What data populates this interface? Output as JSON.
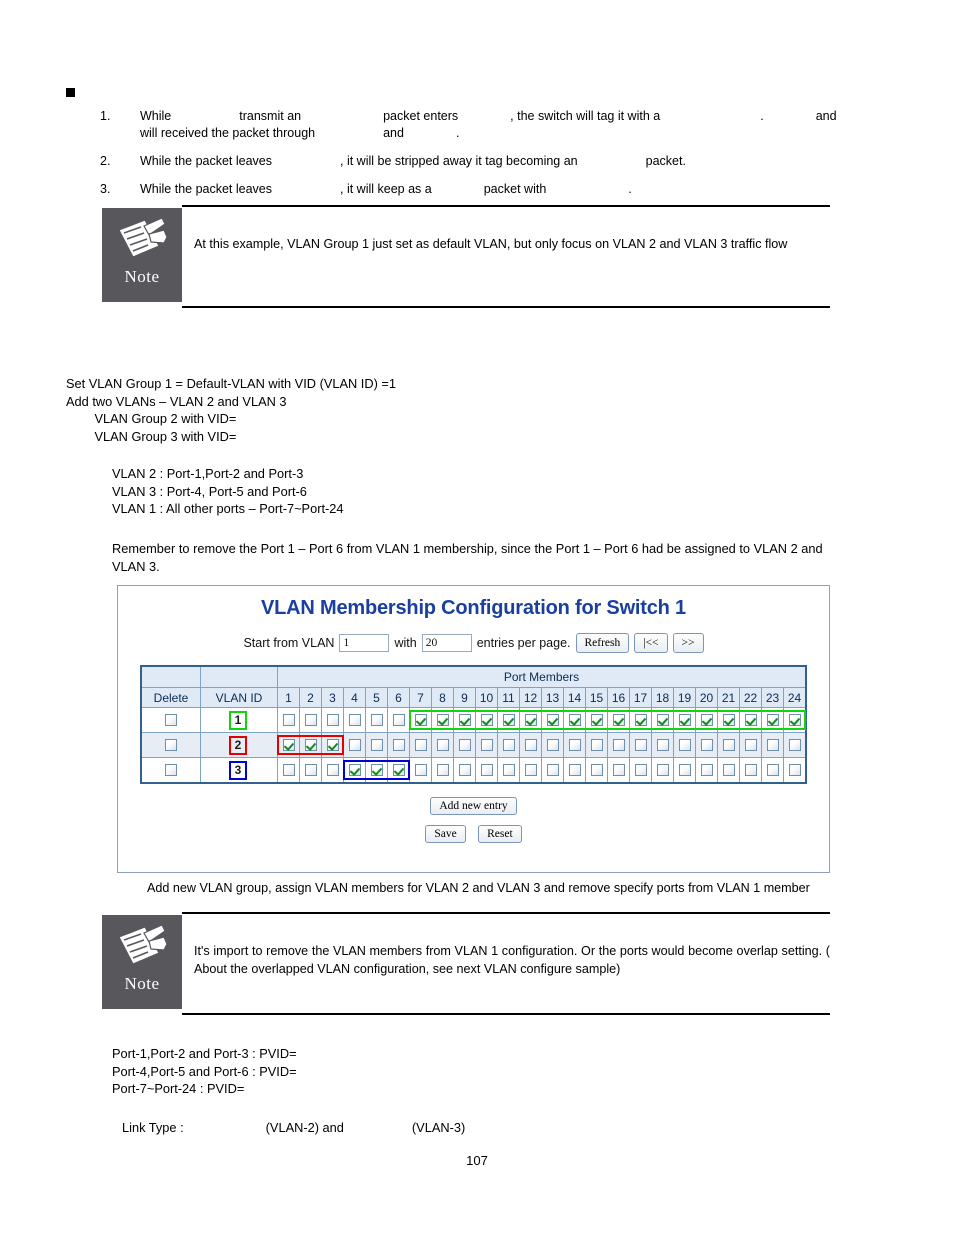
{
  "top_list": {
    "bullet": "square-bullet",
    "items": [
      {
        "num": "1.",
        "line1_a": "While",
        "line1_b": "transmit an",
        "line1_c": "packet enters",
        "line1_d": ", the switch will tag it with a",
        "line1_e": ".",
        "line1_f": "and",
        "line2_a": "will received the packet through",
        "line2_b": "and",
        "line2_c": "."
      },
      {
        "num": "2.",
        "line1_a": "While the packet leaves",
        "line1_b": ", it will be stripped away it tag becoming an",
        "line1_c": "packet."
      },
      {
        "num": "3.",
        "line1_a": "While the packet leaves",
        "line1_b": ", it will keep as a",
        "line1_c": "packet with",
        "line1_d": "."
      }
    ]
  },
  "note_top": {
    "label": "Note",
    "icon": "note-pencil-icon",
    "text": "At this example, VLAN Group 1 just set as default VLAN, but only focus on VLAN 2 and VLAN 3 traffic flow"
  },
  "config_text": {
    "block1": "Set VLAN Group 1 = Default-VLAN with VID (VLAN ID) =1\nAdd two VLANs – VLAN 2 and VLAN 3\n        VLAN Group 2 with VID=\n        VLAN Group 3 with VID=",
    "block2": "VLAN 2 : Port-1,Port-2 and Port-3\nVLAN 3 : Port-4, Port-5 and Port-6\nVLAN 1 : All other ports – Port-7~Port-24",
    "block3": "Remember to remove the Port 1 – Port 6 from VLAN 1 membership, since the Port 1 – Port 6 had be assigned to VLAN 2 and\nVLAN 3."
  },
  "vlan_panel": {
    "title": "VLAN Membership Configuration for Switch 1",
    "controls": {
      "start_label": "Start from VLAN",
      "start_value": "1",
      "with_label": "with",
      "entries_value": "20",
      "entries_label": "entries per page.",
      "refresh_label": "Refresh",
      "first_label": "|<<",
      "next_label": ">>"
    },
    "table": {
      "port_members_header": "Port Members",
      "delete_header": "Delete",
      "vlan_id_header": "VLAN ID",
      "ports": [
        "1",
        "2",
        "3",
        "4",
        "5",
        "6",
        "7",
        "8",
        "9",
        "10",
        "11",
        "12",
        "13",
        "14",
        "15",
        "16",
        "17",
        "18",
        "19",
        "20",
        "21",
        "22",
        "23",
        "24"
      ],
      "rows": [
        {
          "vlan_id": "1",
          "vid_highlight": "#12d312",
          "delete_checked": false,
          "members": [
            false,
            false,
            false,
            false,
            false,
            false,
            true,
            true,
            true,
            true,
            true,
            true,
            true,
            true,
            true,
            true,
            true,
            true,
            true,
            true,
            true,
            true,
            true,
            true
          ],
          "band": {
            "color": "#12d312",
            "from": 7,
            "to": 24
          }
        },
        {
          "vlan_id": "2",
          "vid_highlight": "#e60000",
          "delete_checked": false,
          "members": [
            true,
            true,
            true,
            false,
            false,
            false,
            false,
            false,
            false,
            false,
            false,
            false,
            false,
            false,
            false,
            false,
            false,
            false,
            false,
            false,
            false,
            false,
            false,
            false
          ],
          "band": {
            "color": "#e60000",
            "from": 1,
            "to": 3
          }
        },
        {
          "vlan_id": "3",
          "vid_highlight": "#0000d8",
          "delete_checked": false,
          "members": [
            false,
            false,
            false,
            true,
            true,
            true,
            false,
            false,
            false,
            false,
            false,
            false,
            false,
            false,
            false,
            false,
            false,
            false,
            false,
            false,
            false,
            false,
            false,
            false
          ],
          "band": {
            "color": "#0000d8",
            "from": 4,
            "to": 6
          }
        }
      ]
    },
    "buttons": {
      "add_new_entry": "Add new entry",
      "save": "Save",
      "reset": "Reset"
    }
  },
  "caption": "Add new VLAN group, assign VLAN members for VLAN 2 and VLAN 3 and remove specify ports from VLAN 1 member",
  "note_bottom": {
    "label": "Note",
    "icon": "note-pencil-icon",
    "text": "It's import to remove the VLAN members from VLAN 1 configuration. Or the ports would become overlap setting. ( About the overlapped VLAN configuration, see next VLAN configure sample)"
  },
  "pvid_text": {
    "block1": "Port-1,Port-2 and Port-3 : PVID=\nPort-4,Port-5 and Port-6 : PVID=\nPort-7~Port-24 : PVID=",
    "link_type_a": "Link Type :",
    "link_type_b": "(VLAN-2) and",
    "link_type_c": "(VLAN-3)"
  },
  "page_number": "107"
}
